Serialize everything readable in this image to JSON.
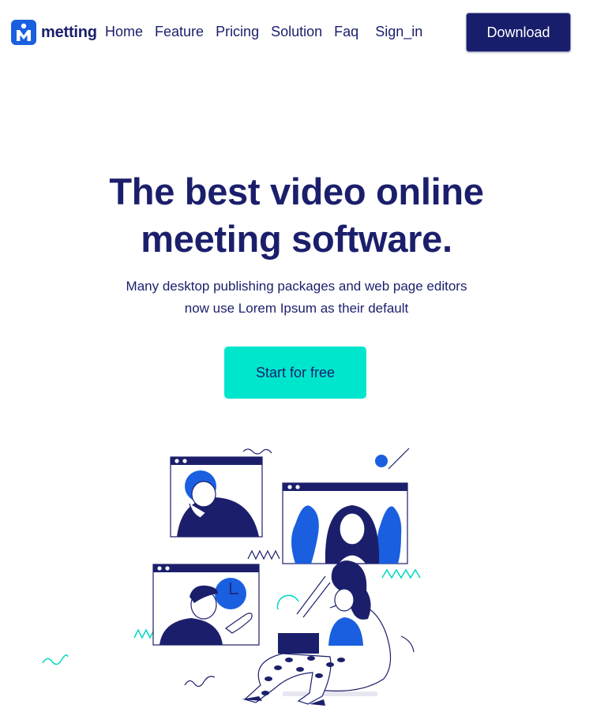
{
  "brand": {
    "name": "metting",
    "logo_icon": "m-letter-logo-icon",
    "color": "#1a5fe0"
  },
  "nav": {
    "links": [
      "Home",
      "Feature",
      "Pricing",
      "Solution",
      "Faq",
      "Sign_in"
    ],
    "download_label": "Download"
  },
  "hero": {
    "title_line1": "The best video online",
    "title_line2": "meeting software.",
    "subtitle_line1": "Many desktop publishing packages and web page editors",
    "subtitle_line2": "now use Lorem Ipsum as their default",
    "cta_label": "Start for free"
  },
  "colors": {
    "navy": "#1b1f6b",
    "accent_teal": "#00e6cd",
    "blue": "#1a5fe0",
    "button_navy": "#181e6b"
  },
  "illustration": {
    "icon": "video-meeting-illustration"
  }
}
